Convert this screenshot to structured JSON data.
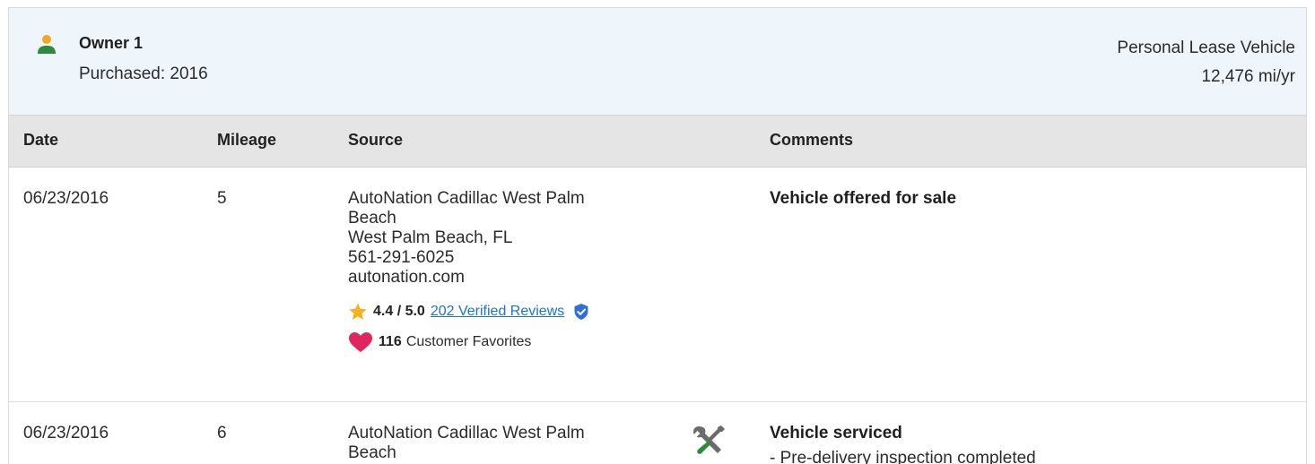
{
  "owner": {
    "title": "Owner 1",
    "purchased": "Purchased: 2016",
    "vehicle_type": "Personal Lease Vehicle",
    "mileage_per_year": "12,476 mi/yr"
  },
  "table": {
    "headers": {
      "date": "Date",
      "mileage": "Mileage",
      "source": "Source",
      "comments": "Comments"
    },
    "rows": [
      {
        "date": "06/23/2016",
        "mileage": "5",
        "source_name_1": "AutoNation Cadillac West Palm",
        "source_name_2": "Beach",
        "location": "West Palm Beach, FL",
        "phone": "561-291-6025",
        "website": "autonation.com",
        "rating": "4.4 / 5.0",
        "reviews": "202 Verified Reviews",
        "favorites_count": "116",
        "favorites_label": "Customer Favorites",
        "comment_title": "Vehicle offered for sale"
      },
      {
        "date": "06/23/2016",
        "mileage": "6",
        "source_name_1": "AutoNation Cadillac West Palm",
        "source_name_2": "Beach",
        "comment_title": "Vehicle serviced",
        "comment_detail": "- Pre-delivery inspection completed"
      }
    ]
  },
  "icons": {
    "owner": "person-icon",
    "rating": "star-icon",
    "verified": "shield-check-icon",
    "favorites": "heart-icon",
    "service": "wrench-screwdriver-icon"
  },
  "colors": {
    "header_bg": "#eef5fb",
    "table_head_bg": "#e5e5e5",
    "owner_icon_body": "#2e8b3d",
    "owner_icon_head": "#f5a623",
    "star": "#f6b21b",
    "heart": "#e0245e",
    "link": "#1b72d8",
    "shield": "#2f6fd6"
  }
}
